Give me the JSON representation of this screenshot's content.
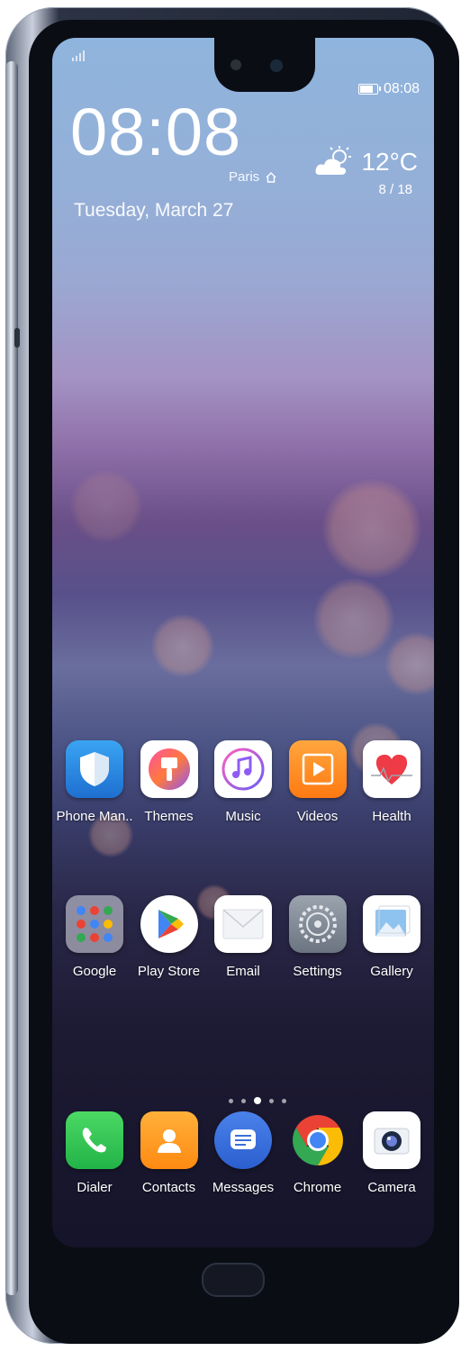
{
  "status_bar": {
    "time": "08:08",
    "battery_level": 0.9,
    "signal_icon": "signal-icon"
  },
  "lockscreen": {
    "clock": "08:08",
    "city": "Paris",
    "date": "Tuesday, March 27",
    "weather": {
      "temperature": "12°C",
      "range": "8 / 18",
      "icon": "partly-cloudy-icon"
    }
  },
  "apps_row1": [
    {
      "label": "Phone Man..",
      "icon": "shield-icon",
      "color": "#2f8ee6"
    },
    {
      "label": "Themes",
      "icon": "paintbrush-icon",
      "color": "#ff7a3c"
    },
    {
      "label": "Music",
      "icon": "music-note-icon",
      "color": "#8e5cf5"
    },
    {
      "label": "Videos",
      "icon": "play-icon",
      "color": "#ff8f1f"
    },
    {
      "label": "Health",
      "icon": "heart-icon",
      "color": "#ee3b45"
    }
  ],
  "apps_row2": [
    {
      "label": "Google",
      "icon": "google-folder-icon"
    },
    {
      "label": "Play Store",
      "icon": "play-store-icon"
    },
    {
      "label": "Email",
      "icon": "envelope-icon"
    },
    {
      "label": "Settings",
      "icon": "gear-icon"
    },
    {
      "label": "Gallery",
      "icon": "image-icon"
    }
  ],
  "dock": [
    {
      "label": "Dialer",
      "icon": "phone-icon",
      "color": "#34c759"
    },
    {
      "label": "Contacts",
      "icon": "contact-icon",
      "color": "#ff9f1a"
    },
    {
      "label": "Messages",
      "icon": "message-icon",
      "color": "#3b6fd8"
    },
    {
      "label": "Chrome",
      "icon": "chrome-icon"
    },
    {
      "label": "Camera",
      "icon": "camera-icon"
    }
  ],
  "page_indicator": {
    "pages": 5,
    "current": 3
  }
}
